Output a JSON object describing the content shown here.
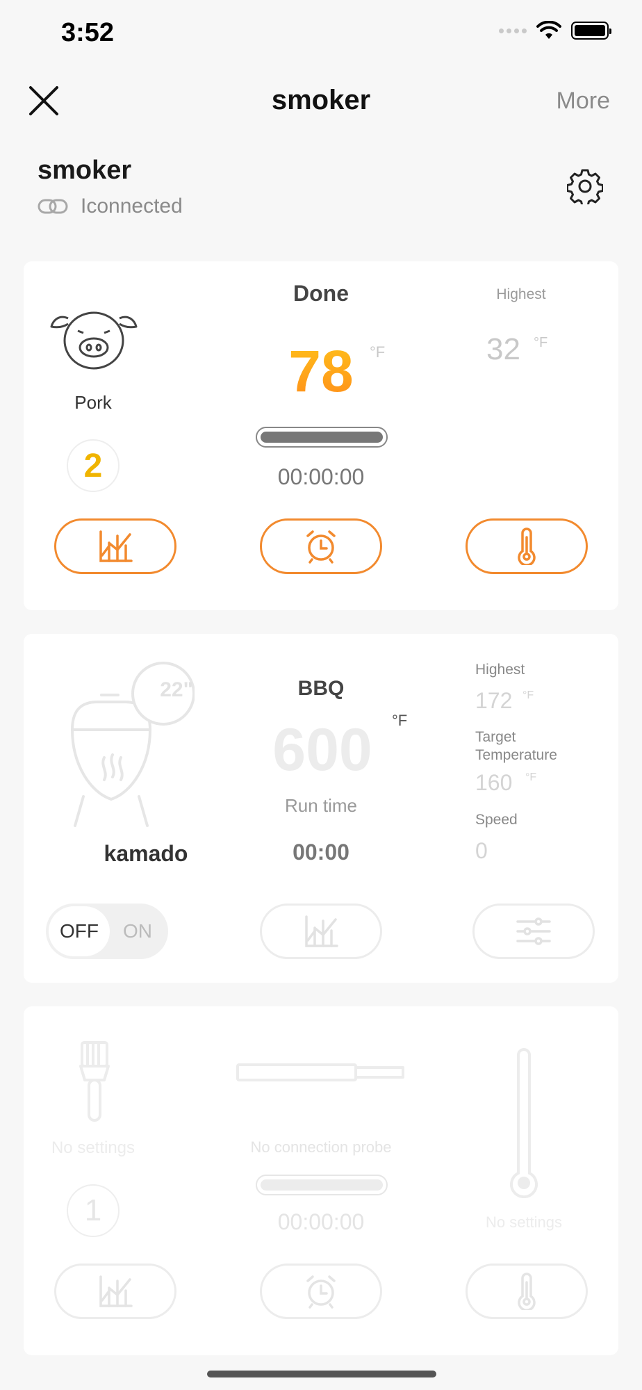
{
  "status_bar": {
    "time": "3:52"
  },
  "nav": {
    "title": "smoker",
    "more_label": "More"
  },
  "device": {
    "name": "smoker",
    "status": "Iconnected"
  },
  "probe_card": {
    "status": "Done",
    "temperature": "78",
    "unit": "°F",
    "highest_label": "Highest",
    "highest_value": "32",
    "highest_unit": "°F",
    "meat_label": "Pork",
    "probe_number": "2",
    "timer": "00:00:00",
    "progress_fraction": 1.0
  },
  "kamado_card": {
    "size_badge": "22\"",
    "grill_name": "kamado",
    "mode": "BBQ",
    "temperature": "600",
    "unit": "°F",
    "runtime_label": "Run time",
    "runtime_value": "00:00",
    "highest_label": "Highest",
    "highest_value": "172",
    "highest_unit": "°F",
    "target_label": "Target Temperature",
    "target_value": "160",
    "target_unit": "°F",
    "speed_label": "Speed",
    "speed_value": "0",
    "toggle_off": "OFF",
    "toggle_on": "ON"
  },
  "empty_card": {
    "left_label": "No settings",
    "center_label": "No connection probe",
    "right_label": "No settings",
    "probe_number": "1",
    "timer": "00:00:00"
  },
  "colors": {
    "accent": "#f28a2e",
    "temp_gradient_top": "#ffc21a",
    "temp_gradient_bottom": "#ff8c1a",
    "probe_number": "#f0b400"
  }
}
